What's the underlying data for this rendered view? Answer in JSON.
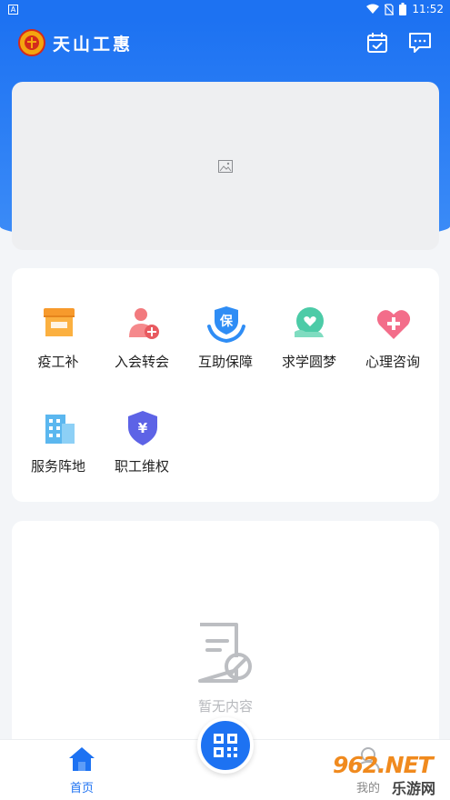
{
  "status_bar": {
    "time": "11:52",
    "app_badge": "A"
  },
  "header": {
    "title": "天山工惠"
  },
  "menu": {
    "items": [
      {
        "label": "疫工补",
        "icon": "shop-icon"
      },
      {
        "label": "入会转会",
        "icon": "user-add-icon"
      },
      {
        "label": "互助保障",
        "icon": "shield-hands-icon"
      },
      {
        "label": "求学圆梦",
        "icon": "heart-hand-icon"
      },
      {
        "label": "心理咨询",
        "icon": "heart-plus-icon"
      },
      {
        "label": "服务阵地",
        "icon": "building-icon"
      },
      {
        "label": "职工维权",
        "icon": "yuan-shield-icon"
      }
    ]
  },
  "shield_char": "保",
  "yuan_char": "¥",
  "content": {
    "empty_text": "暂无内容"
  },
  "tabbar": {
    "home_label": "首页",
    "mine_label": "我的"
  },
  "watermark": {
    "brand": "962.NET",
    "sub": "乐游网"
  },
  "colors": {
    "primary": "#1d72f2",
    "accent_orange": "#f4a50f"
  }
}
